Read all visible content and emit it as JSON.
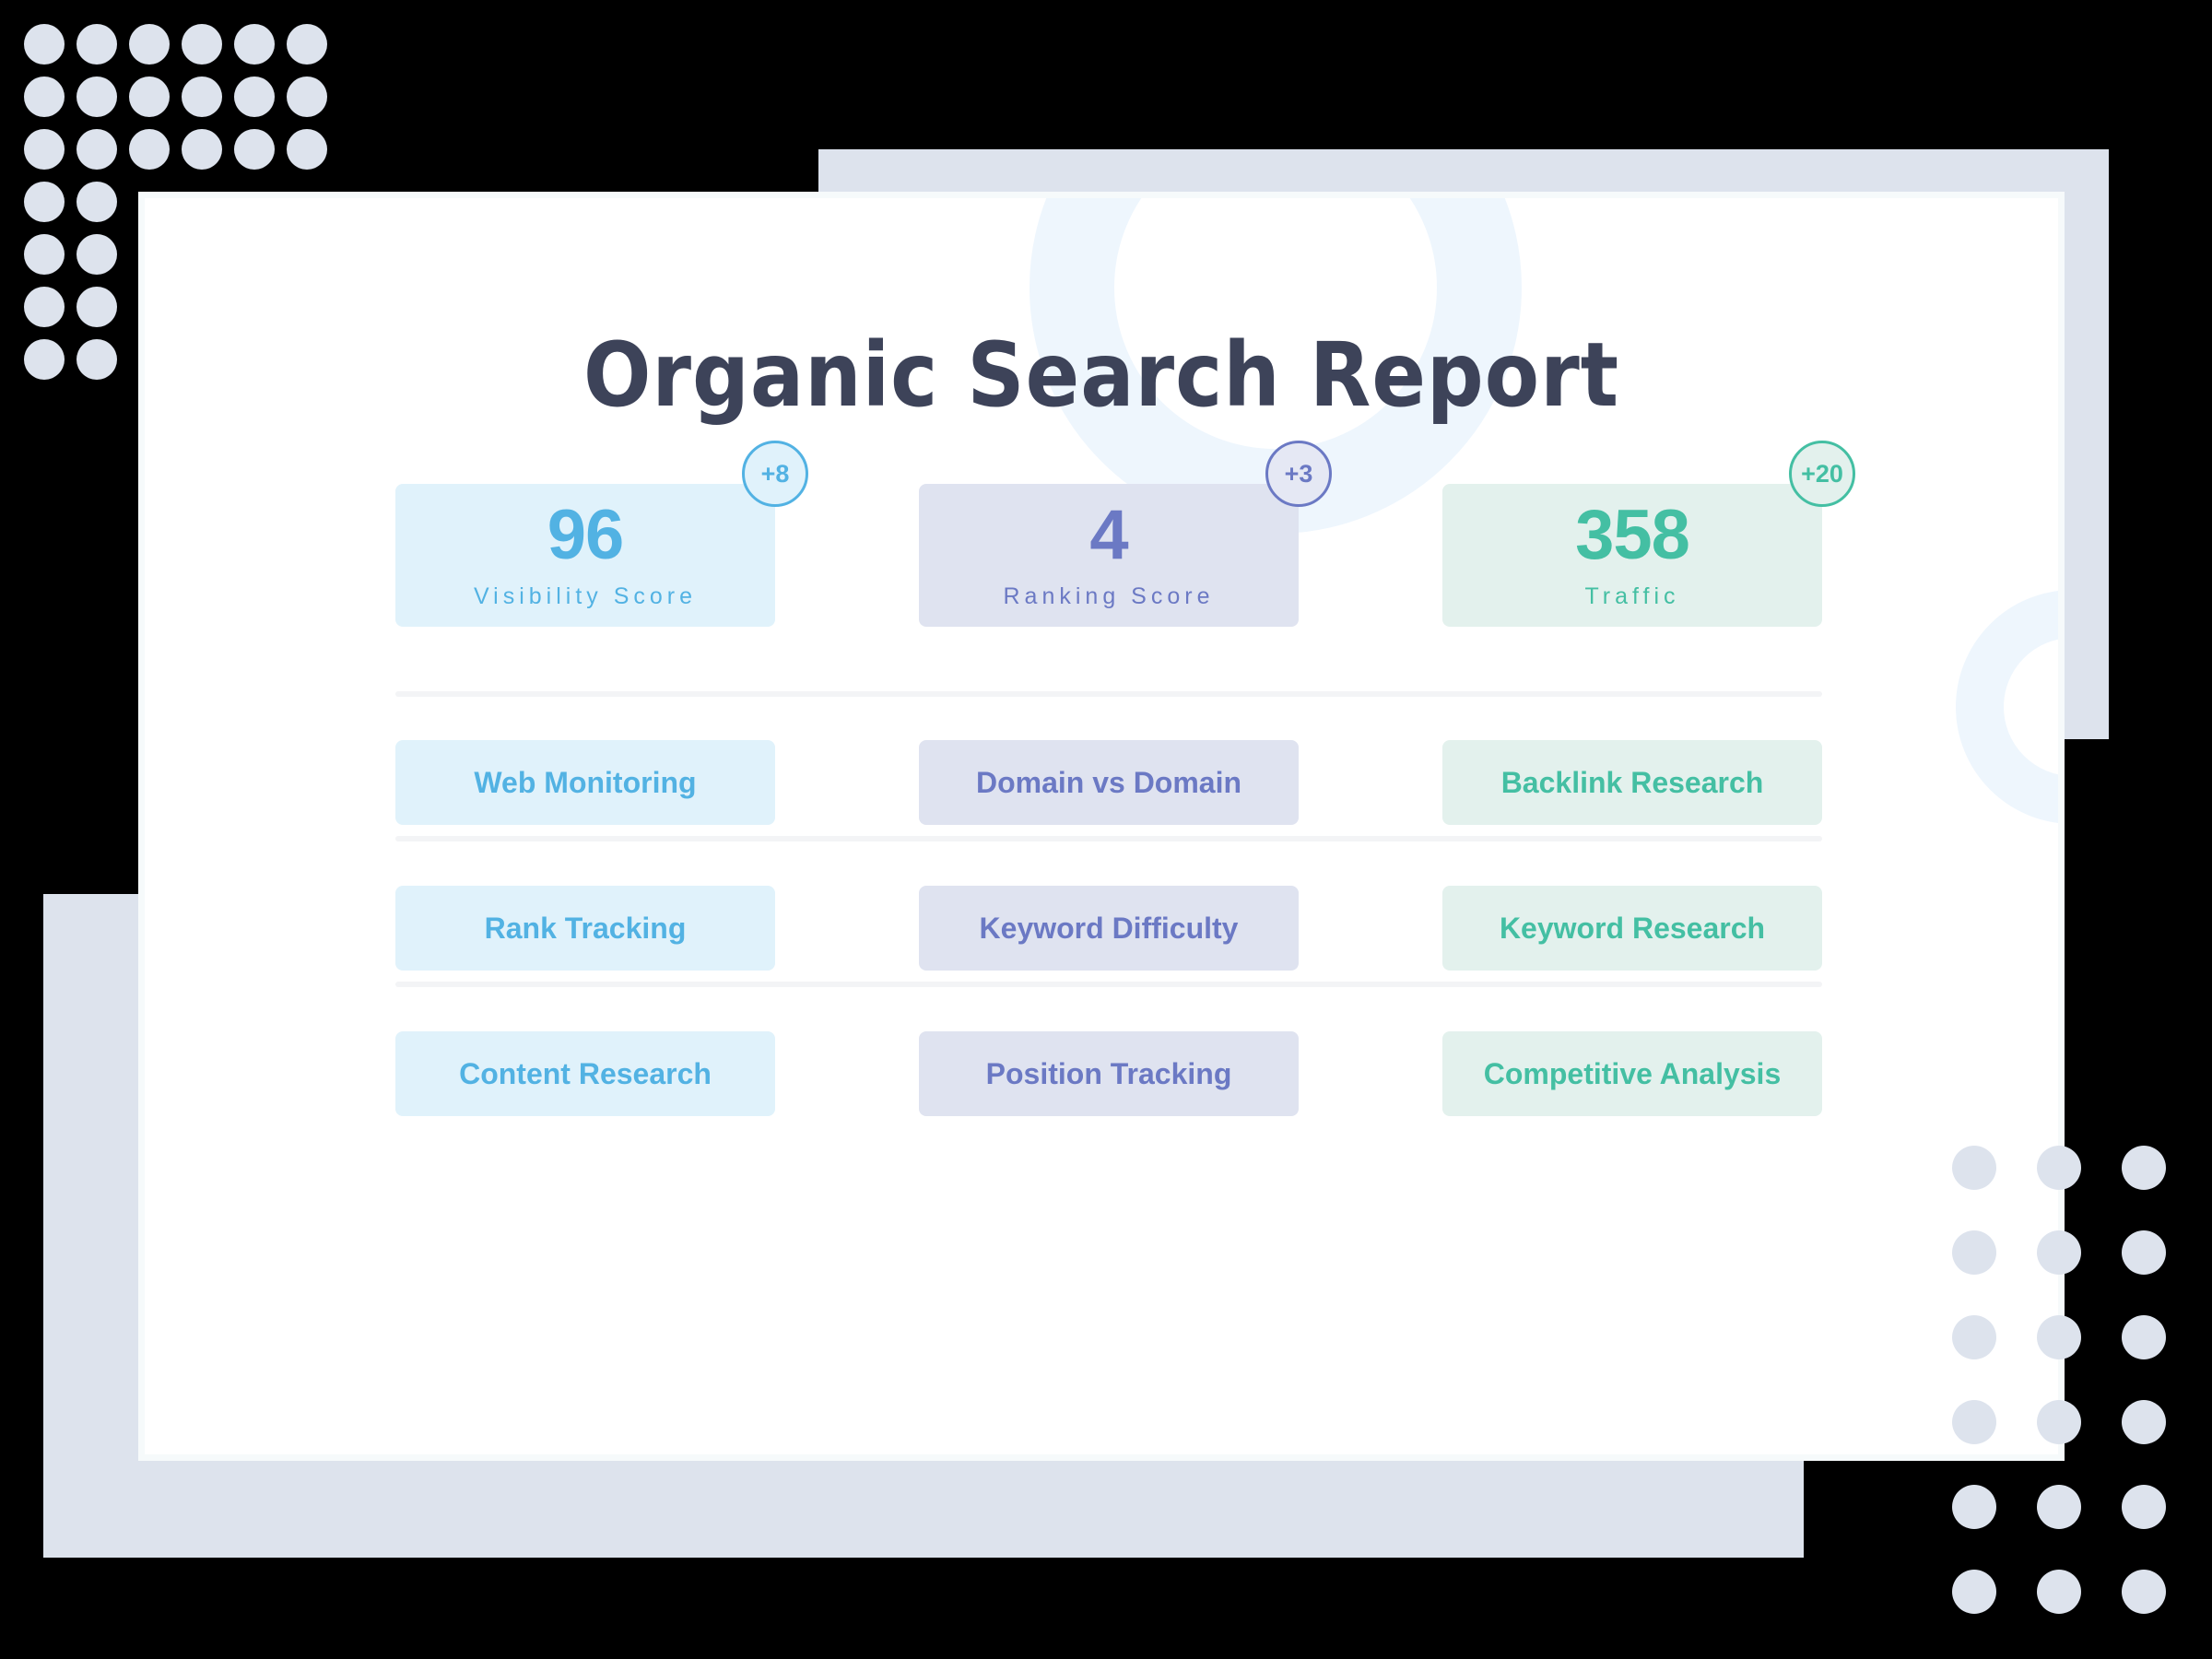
{
  "card": {
    "title": "Organic Search Report"
  },
  "stats": [
    {
      "value": "96",
      "label": "Visibility Score",
      "badge": "+8",
      "theme": "blue",
      "name": "visibility-score"
    },
    {
      "value": "4",
      "label": "Ranking Score",
      "badge": "+3",
      "theme": "purple",
      "name": "ranking-score"
    },
    {
      "value": "358",
      "label": "Traffic",
      "badge": "+20",
      "theme": "green",
      "name": "traffic"
    }
  ],
  "action_rows": [
    [
      {
        "label": "Web Monitoring",
        "theme": "blue",
        "name": "web-monitoring"
      },
      {
        "label": "Domain vs Domain",
        "theme": "purple",
        "name": "domain-vs-domain"
      },
      {
        "label": "Backlink Research",
        "theme": "green",
        "name": "backlink-research"
      }
    ],
    [
      {
        "label": "Rank Tracking",
        "theme": "blue",
        "name": "rank-tracking"
      },
      {
        "label": "Keyword Difficulty",
        "theme": "purple",
        "name": "keyword-difficulty"
      },
      {
        "label": "Keyword Research",
        "theme": "green",
        "name": "keyword-research"
      }
    ],
    [
      {
        "label": "Content Research",
        "theme": "blue",
        "name": "content-research"
      },
      {
        "label": "Position Tracking",
        "theme": "purple",
        "name": "position-tracking"
      },
      {
        "label": "Competitive Analysis",
        "theme": "green",
        "name": "competitive-analysis"
      }
    ]
  ],
  "colors": {
    "background": "#000000",
    "card": "#ffffff",
    "plate": "#dde3ed",
    "dot": "#dde3ed",
    "divider": "#f3f4f6",
    "title": "#3d4359",
    "blue": "#52b2e3",
    "blue_bg": "#e0f2fb",
    "purple": "#6b79c4",
    "purple_bg": "#dfe3f0",
    "green": "#44bfa3",
    "green_bg": "#e3f1ed",
    "ring": "#eef6fd"
  },
  "decor": {
    "dots_top_left": {
      "cols": 6,
      "rows": 7
    },
    "dots_bottom_right": {
      "cols": 3,
      "rows": 6
    }
  }
}
